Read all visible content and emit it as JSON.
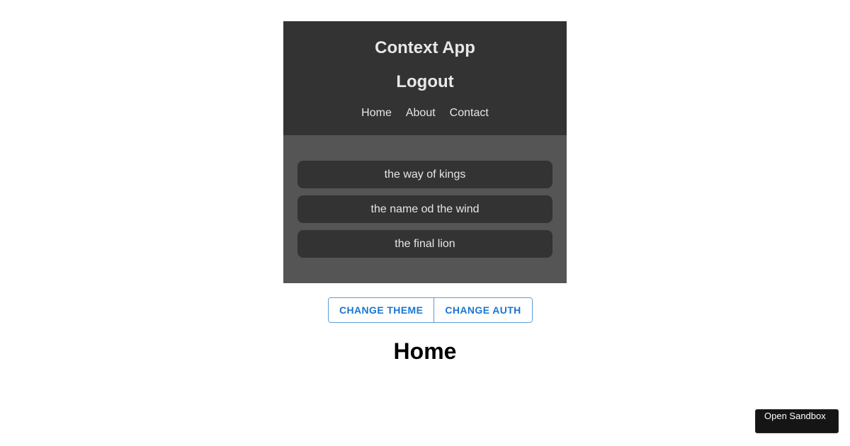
{
  "navbar": {
    "title": "Context App",
    "auth_label": "Logout",
    "links": [
      "Home",
      "About",
      "Contact"
    ]
  },
  "books": [
    "the way of kings",
    "the name od the wind",
    "the final lion"
  ],
  "buttons": {
    "change_theme": "CHANGE THEME",
    "change_auth": "CHANGE AUTH"
  },
  "page": {
    "heading": "Home"
  },
  "sandbox": {
    "label": "Open Sandbox"
  },
  "colors": {
    "navbar_bg": "#333333",
    "panel_bg": "#555555",
    "book_bg": "#333333",
    "button_text": "#1976d2",
    "button_border": "#5b9bd5"
  }
}
